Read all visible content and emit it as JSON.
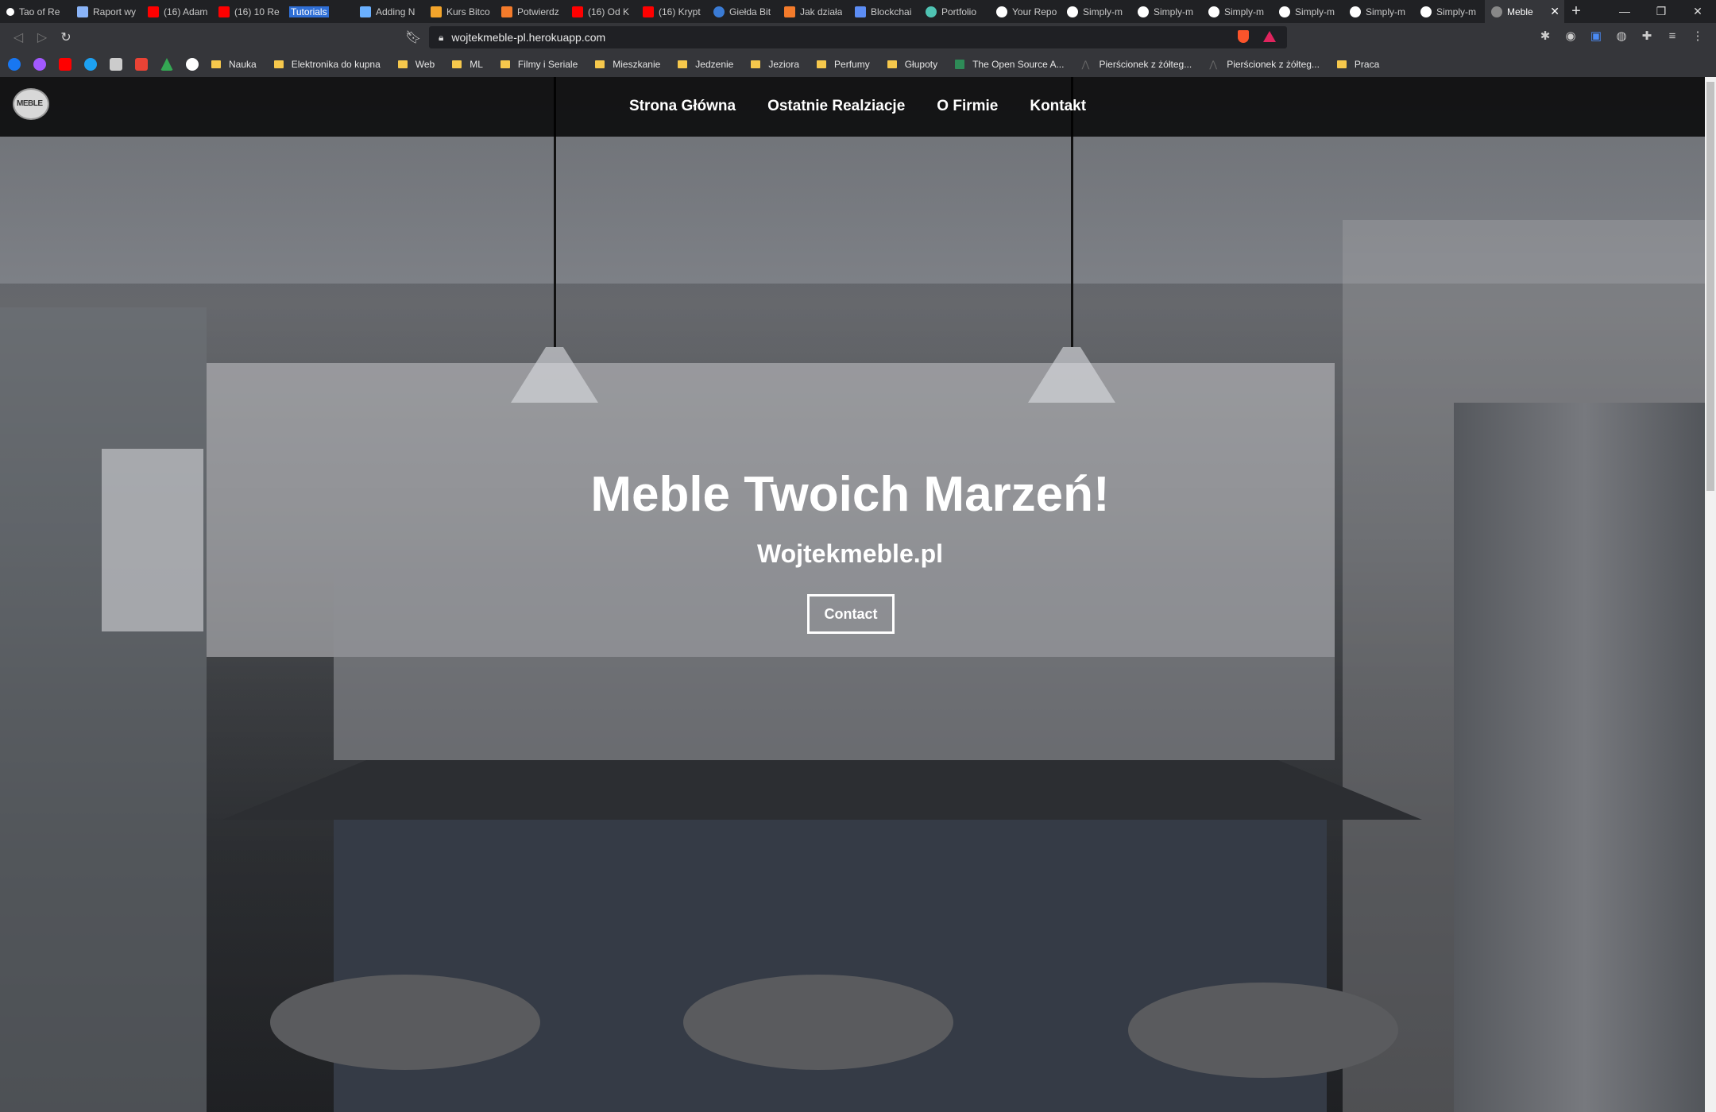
{
  "browser": {
    "tabs": [
      {
        "label": "Tao of Re",
        "color": "#ffffff"
      },
      {
        "label": "Raport wy",
        "color": "#8ab4f8"
      },
      {
        "label": "(16) Adam",
        "color": "#ff0000"
      },
      {
        "label": "(16) 10 Re",
        "color": "#ff0000"
      },
      {
        "label": "Tutorials",
        "color": "#2f6fd6"
      },
      {
        "label": "Adding N",
        "color": "#6ab0ff"
      },
      {
        "label": "Kurs Bitco",
        "color": "#f4a52b"
      },
      {
        "label": "Potwierdz",
        "color": "#f47b2b"
      },
      {
        "label": "(16) Od K",
        "color": "#ff0000"
      },
      {
        "label": "(16) Krypt",
        "color": "#ff0000"
      },
      {
        "label": "Giełda Bit",
        "color": "#3a7bd5"
      },
      {
        "label": "Jak działa",
        "color": "#f47b2b"
      },
      {
        "label": "Blockchai",
        "color": "#5c8df5"
      },
      {
        "label": "Portfolio",
        "color": "#4fc3b3"
      },
      {
        "label": "Your Repo",
        "color": "#ffffff"
      },
      {
        "label": "Simply-m",
        "color": "#ffffff"
      },
      {
        "label": "Simply-m",
        "color": "#ffffff"
      },
      {
        "label": "Simply-m",
        "color": "#ffffff"
      },
      {
        "label": "Simply-m",
        "color": "#ffffff"
      },
      {
        "label": "Simply-m",
        "color": "#ffffff"
      },
      {
        "label": "Simply-m",
        "color": "#ffffff"
      }
    ],
    "active_tab": {
      "label": "Meble",
      "close": "✕"
    },
    "new_tab": "+",
    "window_controls": {
      "minimize": "—",
      "restore": "❐",
      "close": "✕"
    },
    "url": "wojtekmeble-pl.herokuapp.com",
    "bookmarks": [
      {
        "label": "Nauka"
      },
      {
        "label": "Elektronika do kupna"
      },
      {
        "label": "Web"
      },
      {
        "label": "ML"
      },
      {
        "label": "Filmy i Seriale"
      },
      {
        "label": "Mieszkanie"
      },
      {
        "label": "Jedzenie"
      },
      {
        "label": "Jeziora"
      },
      {
        "label": "Perfumy"
      },
      {
        "label": "Głupoty"
      }
    ],
    "bookmark_site": "The Open Source A...",
    "bookmark_links": [
      "Pierścionek z żółteg...",
      "Pierścionek z żółteg..."
    ],
    "bookmark_last": "Praca",
    "bookmark_icon_colors": [
      "#1877f2",
      "#a259ff",
      "#ff0000",
      "#1da1f2",
      "#cccccc",
      "#ea4335",
      "#34a853",
      "#ffffff"
    ]
  },
  "site": {
    "logo_text": "MEBLE",
    "nav": [
      "Strona Główna",
      "Ostatnie Realziacje",
      "O Firmie",
      "Kontakt"
    ],
    "hero_title": "Meble Twoich Marzeń!",
    "hero_subtitle": "Wojtekmeble.pl",
    "hero_button": "Contact"
  }
}
